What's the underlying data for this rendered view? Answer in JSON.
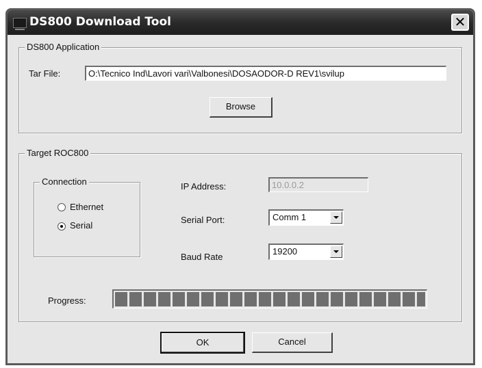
{
  "window": {
    "title": "DS800 Download Tool",
    "close_icon": "close-icon"
  },
  "application_group": {
    "legend": "DS800 Application",
    "tar_file_label": "Tar File:",
    "tar_file_value": "O:\\Tecnico Ind\\Lavori vari\\Valbonesi\\DOSAODOR-D REV1\\svilup",
    "browse_label": "Browse"
  },
  "target_group": {
    "legend": "Target ROC800",
    "connection": {
      "legend": "Connection",
      "options": [
        {
          "label": "Ethernet",
          "checked": false
        },
        {
          "label": "Serial",
          "checked": true
        }
      ]
    },
    "ip_address_label": "IP Address:",
    "ip_address_value": "10.0.0.2",
    "serial_port_label": "Serial Port:",
    "serial_port_value": "Comm 1",
    "baud_rate_label": "Baud Rate",
    "baud_rate_value": "19200",
    "progress_label": "Progress:",
    "progress_fraction": 1.0
  },
  "buttons": {
    "ok_label": "OK",
    "cancel_label": "Cancel"
  }
}
